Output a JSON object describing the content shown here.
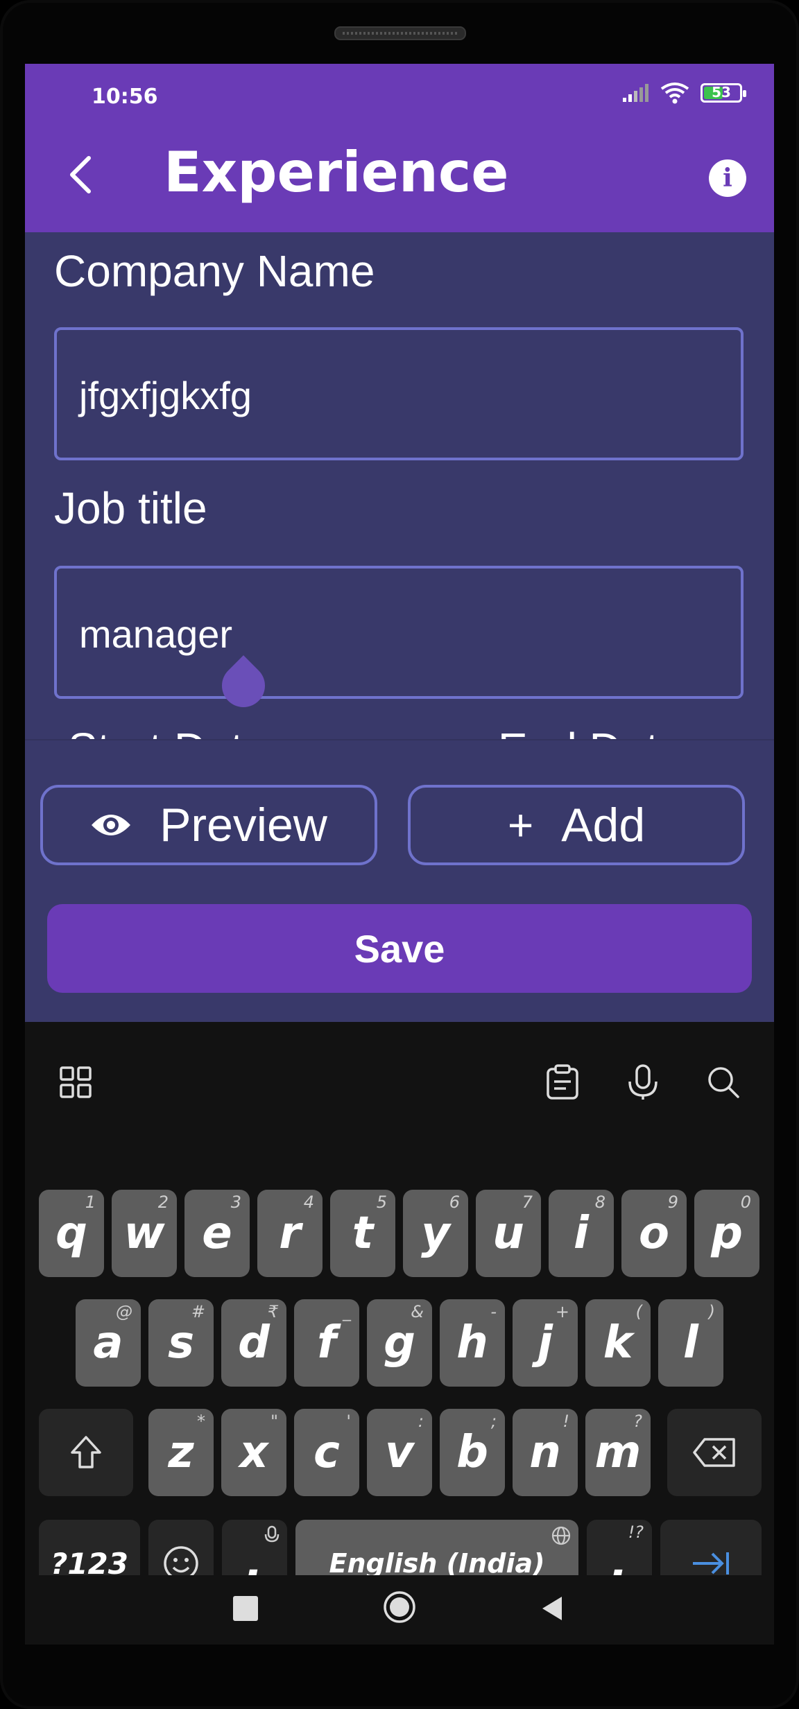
{
  "status_bar": {
    "time": "10:56",
    "battery": "53",
    "battery_level": 0.53
  },
  "app_bar": {
    "title": "Experience"
  },
  "form": {
    "company_label": "Company Name",
    "company_value": "jfgxfjgkxfg",
    "job_label": "Job title",
    "job_value": "manager",
    "start_label_partial": "Start Date",
    "end_label_partial": "End Date"
  },
  "actions": {
    "preview_label": "Preview",
    "add_symbol": "+",
    "add_label": "Add",
    "save_label": "Save"
  },
  "keyboard": {
    "row1": [
      {
        "k": "q",
        "s": "1"
      },
      {
        "k": "w",
        "s": "2"
      },
      {
        "k": "e",
        "s": "3"
      },
      {
        "k": "r",
        "s": "4"
      },
      {
        "k": "t",
        "s": "5"
      },
      {
        "k": "y",
        "s": "6"
      },
      {
        "k": "u",
        "s": "7"
      },
      {
        "k": "i",
        "s": "8"
      },
      {
        "k": "o",
        "s": "9"
      },
      {
        "k": "p",
        "s": "0"
      }
    ],
    "row2": [
      {
        "k": "a",
        "s": "@"
      },
      {
        "k": "s",
        "s": "#"
      },
      {
        "k": "d",
        "s": "₹"
      },
      {
        "k": "f",
        "s": "_"
      },
      {
        "k": "g",
        "s": "&"
      },
      {
        "k": "h",
        "s": "-"
      },
      {
        "k": "j",
        "s": "+"
      },
      {
        "k": "k",
        "s": "("
      },
      {
        "k": "l",
        "s": ")"
      }
    ],
    "row3": [
      {
        "k": "z",
        "s": "*"
      },
      {
        "k": "x",
        "s": "\""
      },
      {
        "k": "c",
        "s": "'"
      },
      {
        "k": "v",
        "s": ":"
      },
      {
        "k": "b",
        "s": ";"
      },
      {
        "k": "n",
        "s": "!"
      },
      {
        "k": "m",
        "s": "?"
      }
    ],
    "symbols_key": "?123",
    "comma_key": ",",
    "space_label": "English (India)",
    "period_key": ".",
    "period_sup": "!?"
  },
  "icons": {
    "back": "chevron-left-icon",
    "info": "info-icon",
    "preview": "eye-icon",
    "kb_apps": "grid-icon",
    "kb_clipboard": "clipboard-icon",
    "kb_mic": "mic-icon",
    "kb_search": "search-icon"
  },
  "colors": {
    "app_bar": "#6a3bb6",
    "background": "#39396a",
    "outline": "#6f72cc",
    "keyboard_bg": "#121212",
    "key": "#5d5d5d",
    "enter_arrow": "#4a8fe0"
  }
}
